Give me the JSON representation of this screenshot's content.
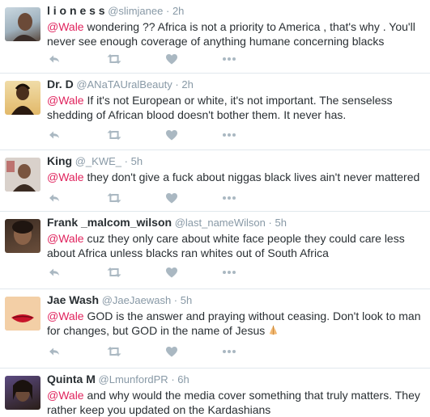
{
  "tweets": [
    {
      "name": "l i o n e s s",
      "handle": "@slimjanee",
      "sep": "·",
      "time": "2h",
      "mention": "@Wale",
      "text": " wondering ?? Africa is not a priority to America , that's why . You'll never see enough coverage of anything humane concerning blacks",
      "avatar_colors": [
        "#c9d7e0",
        "#5a4a3f"
      ]
    },
    {
      "name": "Dr. D",
      "handle": "@ANaTAUralBeauty",
      "sep": "·",
      "time": "2h",
      "mention": "@Wale",
      "text": " If it's not European or white, it's not important. The senseless shedding of African blood doesn't bother them. It never has.",
      "avatar_colors": [
        "#e9c98a",
        "#3a2618"
      ]
    },
    {
      "name": "King",
      "handle": "@_KWE_",
      "sep": "·",
      "time": "5h",
      "mention": "@Wale",
      "text": " they don't give a fuck about niggas black lives ain't never mattered",
      "avatar_colors": [
        "#d8cfc8",
        "#6b4c3b"
      ]
    },
    {
      "name": "Frank _malcom_wilson",
      "handle": "@last_nameWilson",
      "sep": "·",
      "time": "5h",
      "mention": "@Wale",
      "text": " cuz they only care about white face people they could care less about Africa unless blacks ran whites out of South Africa",
      "avatar_colors": [
        "#3a2b22",
        "#8a6a50"
      ]
    },
    {
      "name": "Jae Wash",
      "handle": "@JaeJaewash",
      "sep": "·",
      "time": "5h",
      "mention": "@Wale",
      "text": " GOD is the answer and praying without ceasing. Don't look to man for changes, but GOD in the name of Jesus ",
      "emoji": "folded-hands-emoji",
      "avatar_colors": [
        "#f2c79e",
        "#c8142a"
      ]
    },
    {
      "name": "Quinta M",
      "handle": "@LmunfordPR",
      "sep": "·",
      "time": "6h",
      "mention": "@Wale",
      "text": " and why would the media cover something that truly matters. They rather keep you updated on the Kardashians",
      "avatar_colors": [
        "#4a3a6a",
        "#2a1e18"
      ]
    }
  ],
  "icons": {
    "reply": "reply-icon",
    "retweet": "retweet-icon",
    "like": "heart-icon",
    "more": "more-icon"
  },
  "colors": {
    "icon": "#aab8c2",
    "mention": "#e0245e",
    "meta": "#8899a6",
    "divider": "#e1e8ed"
  }
}
